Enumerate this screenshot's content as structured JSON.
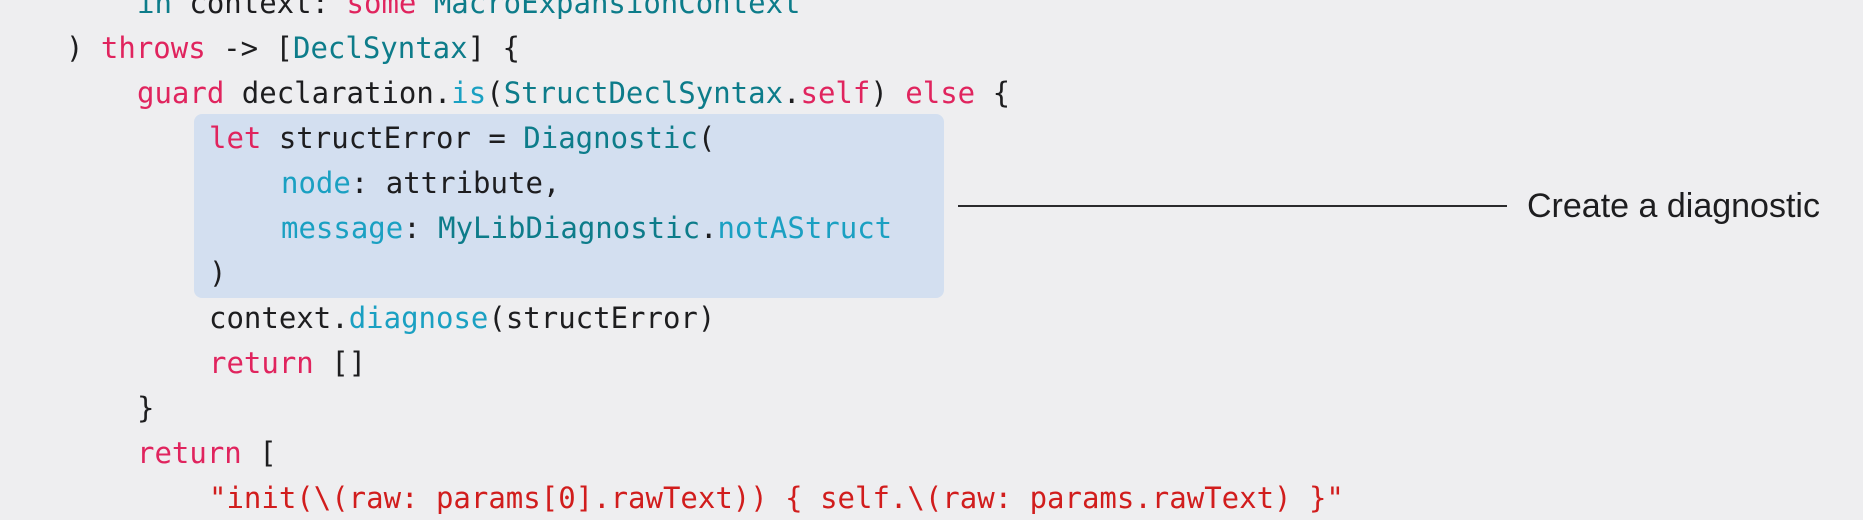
{
  "code": {
    "line1": {
      "t1": "in",
      "t2": " context: ",
      "t3": "some",
      "t4": " MacroExpansionContext"
    },
    "line2": {
      "t1": ") ",
      "t2": "throws",
      "t3": " -> [",
      "t4": "DeclSyntax",
      "t5": "] {"
    },
    "line3": {
      "t1": "guard",
      "t2": " declaration.",
      "t3": "is",
      "t4": "(",
      "t5": "StructDeclSyntax",
      "t6": ".",
      "t7": "self",
      "t8": ") ",
      "t9": "else",
      "t10": " {"
    },
    "line4": {
      "t1": "let",
      "t2": " structError = ",
      "t3": "Diagnostic",
      "t4": "("
    },
    "line5": {
      "t1": "node",
      "t2": ": attribute,"
    },
    "line6": {
      "t1": "message",
      "t2": ": ",
      "t3": "MyLibDiagnostic",
      "t4": ".",
      "t5": "notAStruct"
    },
    "line7": {
      "t1": ")"
    },
    "line8": {
      "t1": "context.",
      "t2": "diagnose",
      "t3": "(structError)"
    },
    "line9": {
      "t1": "return",
      "t2": " []"
    },
    "line10": {
      "t1": "}"
    },
    "line11": {
      "t1": "return",
      "t2": " ["
    },
    "line12": {
      "t1": "\"init(\\(raw: params[0].rawText)) { self.\\(raw: params.rawText) }\""
    }
  },
  "callout": {
    "label": "Create a diagnostic"
  },
  "colors": {
    "background": "#eeeef0",
    "keyword": "#e0245e",
    "type": "#0d7c8a",
    "member": "#1aa0c2",
    "string": "#d11d1d",
    "highlight": "#d3dff0"
  }
}
